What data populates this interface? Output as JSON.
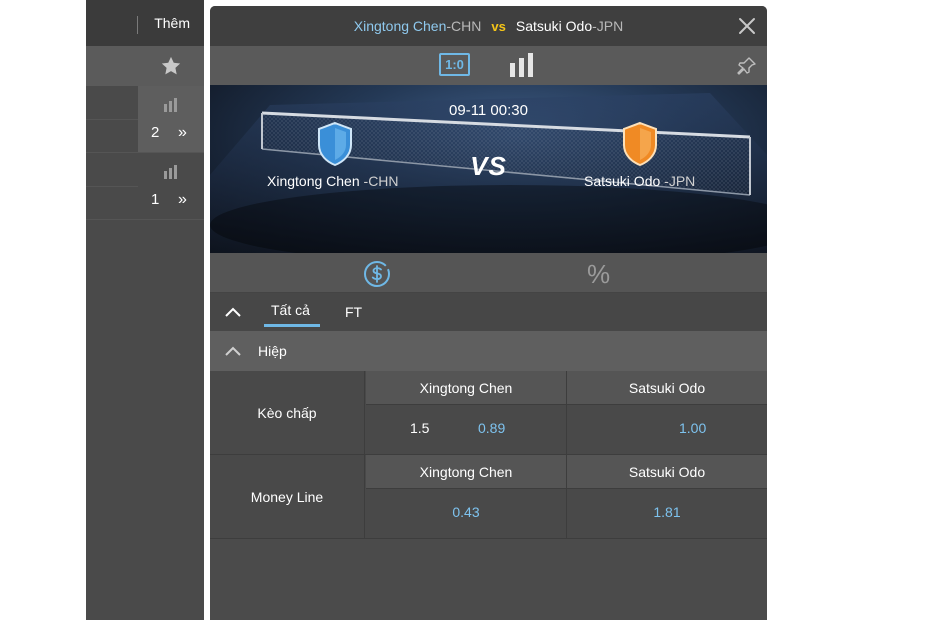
{
  "left_panel": {
    "header_label": "Thêm",
    "rows": [
      {
        "count": "2",
        "chevron": "»"
      },
      {
        "count": "1",
        "chevron": "»"
      }
    ]
  },
  "event": {
    "home_team": "Xingtong Chen",
    "home_suffix": "-CHN",
    "away_team": "Satsuki Odo",
    "away_suffix": "-JPN",
    "vs_label": "vs",
    "vs_big": "VS",
    "datetime": "09-11 00:30",
    "score_label": "1:0"
  },
  "markets_bar": {
    "percent_label": "%"
  },
  "tabs": {
    "all_label": "Tất cả",
    "ft_label": "FT"
  },
  "section": {
    "title": "Hiệp"
  },
  "markets": [
    {
      "name": "Kèo chấp",
      "home_header": "Xingtong Chen",
      "away_header": "Satsuki Odo",
      "home_line": "1.5",
      "home_price": "0.89",
      "away_price": "1.00"
    },
    {
      "name": "Money Line",
      "home_header": "Xingtong Chen",
      "away_header": "Satsuki Odo",
      "home_price": "0.43",
      "away_price": "1.81"
    }
  ],
  "colors": {
    "accent": "#6fb8e6",
    "odds": "#7ec3ef",
    "vs": "#f5c518",
    "home_shield": "#3a8fd8",
    "away_shield": "#f08a24"
  },
  "icons": {
    "star": "star-icon",
    "stats": "bar-chart-icon",
    "close": "close-icon",
    "pin": "pin-icon",
    "money": "dollar-circle-icon",
    "collapse": "chevron-up-icon"
  }
}
